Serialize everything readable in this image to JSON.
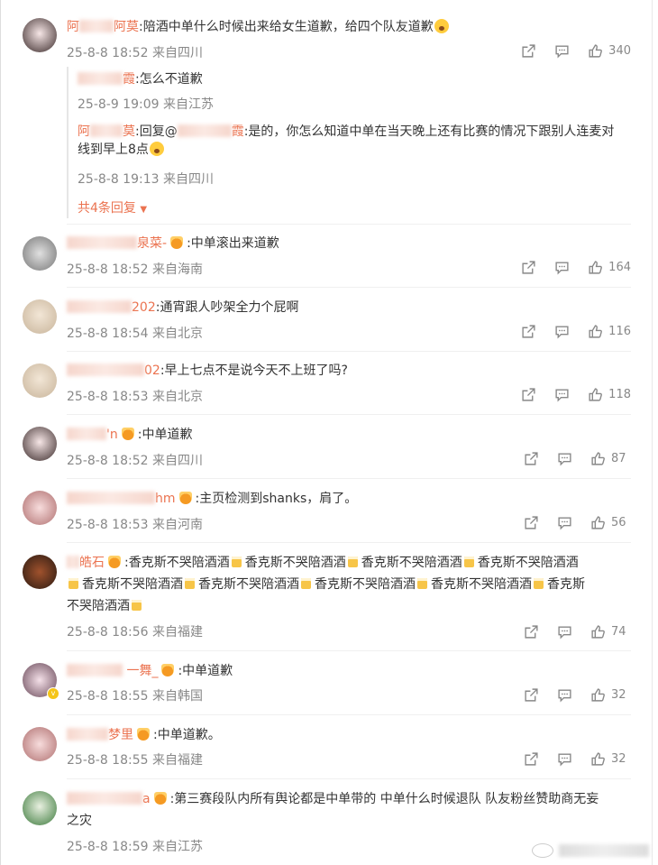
{
  "comments": [
    {
      "name_visible": "阿",
      "name_tail": "阿莫",
      "verified": false,
      "text": ":陪酒中单什么时候出来给女生道歉，给四个队友道歉",
      "emoji": true,
      "time": "25-8-8 18:52",
      "location": "来自四川",
      "likes": "340",
      "replies": [
        {
          "name_tail": "霞",
          "text": ":怎么不道歉",
          "time": "25-8-9 19:09",
          "location": "来自江苏"
        },
        {
          "name_head": "阿",
          "name_tail": "莫",
          "reply_to_tail": "霞",
          "reply_prefix": ":回复@",
          "text_line1": ":是的，你怎么知道中单在当天晚上还有比赛的情况下跟别人连麦对",
          "text_line2": "线到早上8点",
          "time": "25-8-8 19:13",
          "location": "来自四川"
        }
      ],
      "more": "共4条回复"
    },
    {
      "name_tail": "泉菜-",
      "crown": true,
      "text": ":中单滚出来道歉",
      "time": "25-8-8 18:52",
      "location": "来自海南",
      "likes": "164"
    },
    {
      "name_tail": "202",
      "crown": false,
      "text": ":通宵跟人吵架全力个屁啊",
      "time": "25-8-8 18:54",
      "location": "来自北京",
      "likes": "116"
    },
    {
      "name_tail": "02",
      "crown": false,
      "text": ":早上七点不是说今天不上班了吗?",
      "time": "25-8-8 18:53",
      "location": "来自北京",
      "likes": "118"
    },
    {
      "name_tail": "'n",
      "crown": true,
      "text": ":中单道歉",
      "time": "25-8-8 18:52",
      "location": "来自四川",
      "likes": "87"
    },
    {
      "name_tail": "hm",
      "crown": true,
      "text": ":主页检测到shanks，肩了。",
      "time": "25-8-8 18:53",
      "location": "来自河南",
      "likes": "56"
    },
    {
      "name_tail": "皓石",
      "crown": true,
      "text_line1": ":香克斯不哭陪酒酒",
      "repeat": "香克斯不哭陪酒酒",
      "text_line3": "不哭陪酒酒",
      "time": "25-8-8 18:56",
      "location": "来自福建",
      "likes": "74"
    },
    {
      "name_tail": "一舞_",
      "crown": true,
      "verified": true,
      "text": ":中单道歉",
      "time": "25-8-8 18:55",
      "location": "来自韩国",
      "likes": "32"
    },
    {
      "name_tail": "梦里",
      "crown": true,
      "text": ":中单道歉。",
      "time": "25-8-8 18:55",
      "location": "来自福建",
      "likes": "32"
    },
    {
      "name_tail": "a",
      "crown": true,
      "text_line1": ":第三赛段队内所有舆论都是中单带的 中单什么时候退队 队友粉丝赞助商无妄",
      "text_line2": "之灾",
      "time": "25-8-8 18:59",
      "location": "来自江苏"
    }
  ],
  "icons": {
    "share": "share-icon",
    "comment": "comment-icon",
    "like": "thumbs-up-icon"
  },
  "colors": {
    "username": "#eb7350",
    "meta": "#888888"
  }
}
